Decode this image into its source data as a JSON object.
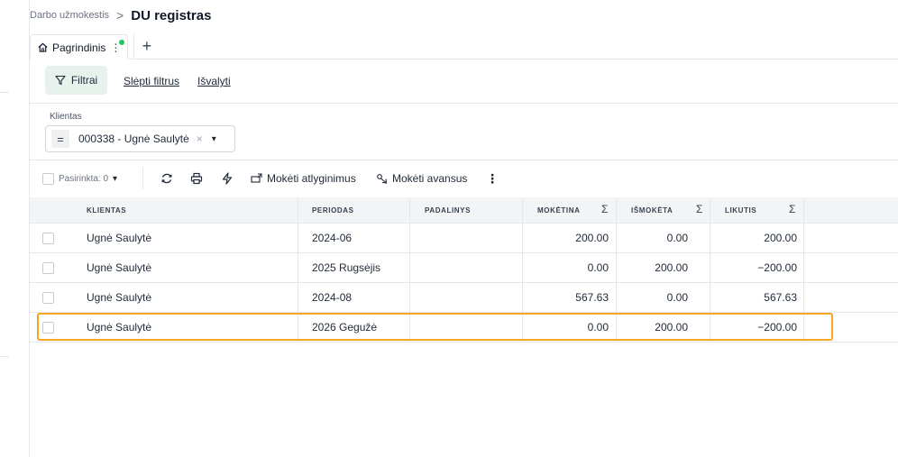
{
  "breadcrumb": {
    "parent": "Darbo užmokestis",
    "separator": ">",
    "title": "DU registras"
  },
  "tabs": [
    {
      "label": "Pagrindinis",
      "status_color": "#22c55e"
    }
  ],
  "tab_add_label": "+",
  "filterbar": {
    "filter_button": "Filtrai",
    "hide_filters": "Slėpti filtrus",
    "clear": "Išvalyti"
  },
  "client_filter": {
    "label": "Klientas",
    "operator": "=",
    "value": "000338 - Ugnė Saulytė",
    "clear_symbol": "×"
  },
  "toolbar": {
    "selected": "Pasirinkta: 0",
    "pay_salary": "Mokėti atlyginimus",
    "pay_advance": "Mokėti avansus"
  },
  "table": {
    "columns": [
      "KLIENTAS",
      "PERIODAS",
      "PADALINYS",
      "MOKĖTINA",
      "IŠMOKĖTA",
      "LIKUTIS"
    ],
    "sum_symbol": "Σ",
    "rows": [
      {
        "client": "Ugnė Saulytė",
        "period": "2024-06",
        "unit": "",
        "payable": "200.00",
        "paid": "0.00",
        "balance": "200.00"
      },
      {
        "client": "Ugnė Saulytė",
        "period": "2025 Rugsėjis",
        "unit": "",
        "payable": "0.00",
        "paid": "200.00",
        "balance": "−200.00"
      },
      {
        "client": "Ugnė Saulytė",
        "period": "2024-08",
        "unit": "",
        "payable": "567.63",
        "paid": "0.00",
        "balance": "567.63"
      },
      {
        "client": "Ugnė Saulytė",
        "period": "2026 Gegužė",
        "unit": "",
        "payable": "0.00",
        "paid": "200.00",
        "balance": "−200.00"
      }
    ]
  },
  "colors": {
    "accent_green": "#e8f2ec",
    "highlight": "#f5a623",
    "status_dot": "#22c55e"
  }
}
